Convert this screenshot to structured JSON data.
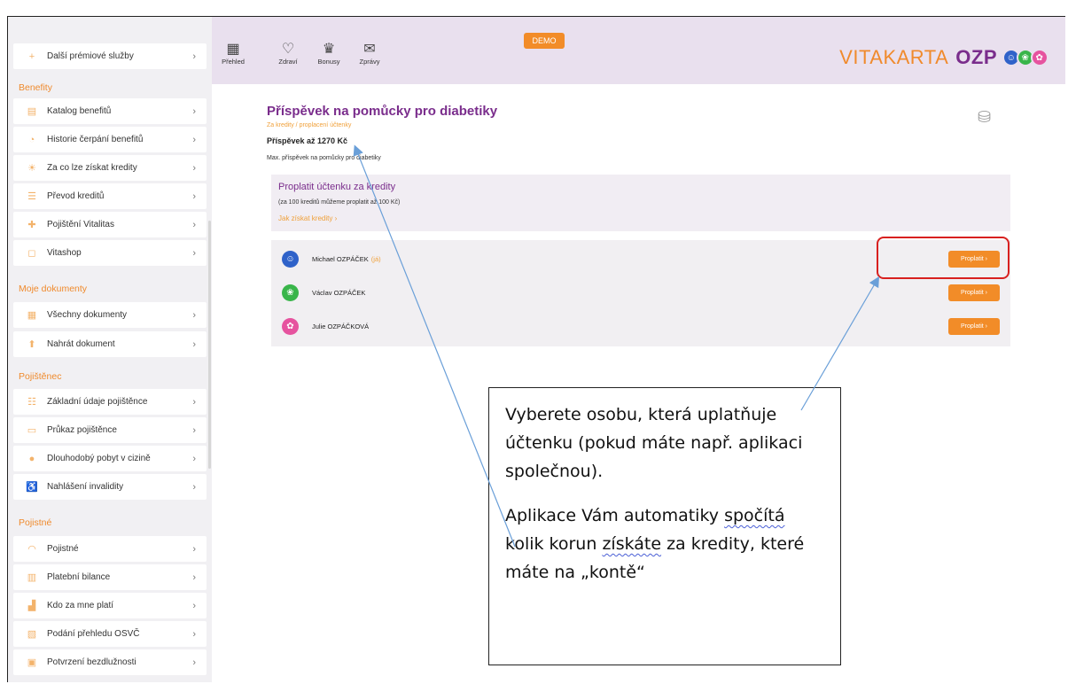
{
  "sidebar": {
    "items_top": [
      {
        "label": "Další prémiové služby",
        "icon": "plus-icon"
      }
    ],
    "sections": [
      {
        "heading": "Benefity",
        "items": [
          {
            "label": "Katalog benefitů",
            "icon": "catalog-icon"
          },
          {
            "label": "Historie čerpání benefitů",
            "icon": "history-icon"
          },
          {
            "label": "Za co lze získat kredity",
            "icon": "credits-icon"
          },
          {
            "label": "Převod kreditů",
            "icon": "transfer-icon"
          },
          {
            "label": "Pojištění Vitalitas",
            "icon": "insurance-icon"
          },
          {
            "label": "Vitashop",
            "icon": "shop-icon"
          }
        ]
      },
      {
        "heading": "Moje dokumenty",
        "items": [
          {
            "label": "Všechny dokumenty",
            "icon": "documents-icon"
          },
          {
            "label": "Nahrát dokument",
            "icon": "upload-icon"
          }
        ]
      },
      {
        "heading": "Pojištěnec",
        "items": [
          {
            "label": "Základní údaje pojištěnce",
            "icon": "list-icon"
          },
          {
            "label": "Průkaz pojištěnce",
            "icon": "card-icon"
          },
          {
            "label": "Dlouhodobý pobyt v cizině",
            "icon": "location-icon"
          },
          {
            "label": "Nahlášení invalidity",
            "icon": "wheelchair-icon"
          }
        ]
      },
      {
        "heading": "Pojistné",
        "items": [
          {
            "label": "Pojistné",
            "icon": "premium-icon"
          },
          {
            "label": "Platební bilance",
            "icon": "balance-icon"
          },
          {
            "label": "Kdo za mne platí",
            "icon": "payer-icon"
          },
          {
            "label": "Podání přehledu OSVČ",
            "icon": "report-icon"
          },
          {
            "label": "Potvrzení bezdlužnosti",
            "icon": "confirmation-icon"
          }
        ]
      }
    ]
  },
  "topbar": {
    "nav": [
      {
        "label": "Přehled",
        "icon": "grid-icon"
      },
      {
        "label": "Zdraví",
        "icon": "heart-icon"
      },
      {
        "label": "Bonusy",
        "icon": "bonus-icon"
      },
      {
        "label": "Zprávy",
        "icon": "mail-icon"
      }
    ],
    "demo_badge": "DEMO",
    "brand_left": "VITAKARTA",
    "brand_right": "OZP"
  },
  "main": {
    "title": "Příspěvek na pomůcky pro diabetiky",
    "subtitle": "Za kredity / proplacení účtenky",
    "amount": "Příspěvek až 1270 Kč",
    "description": "Max. příspěvek na pomůcky pro diabetiky",
    "panel": {
      "title": "Proplatit účtenku za kredity",
      "note": "(za 100 kreditů můžeme proplatit až 100 Kč)",
      "link": "Jak získat kredity ›"
    },
    "persons": [
      {
        "name": "Michael OZPÁČEK",
        "suffix": "(já)",
        "button": "Proplatit ›",
        "color": "#2f62c9"
      },
      {
        "name": "Václav OZPÁČEK",
        "suffix": "",
        "button": "Proplatit ›",
        "color": "#39b54a"
      },
      {
        "name": "Julie OZPÁČKOVÁ",
        "suffix": "",
        "button": "Proplatit ›",
        "color": "#e6539f"
      }
    ]
  },
  "callout": {
    "para1": "Vyberete osobu, která uplatňuje účtenku (pokud máte např. aplikaci společnou).",
    "para2_a": "Aplikace Vám automatiky ",
    "para2_w1": "spočítá",
    "para2_b": " kolik korun ",
    "para2_w2": "získáte",
    "para2_c": " za kredity, které máte na „kontě“"
  },
  "colors": {
    "accent_orange": "#f28c28",
    "brand_purple": "#7a2d8c",
    "highlight_red": "#d8201f",
    "arrow_blue": "#6a9fd8"
  }
}
